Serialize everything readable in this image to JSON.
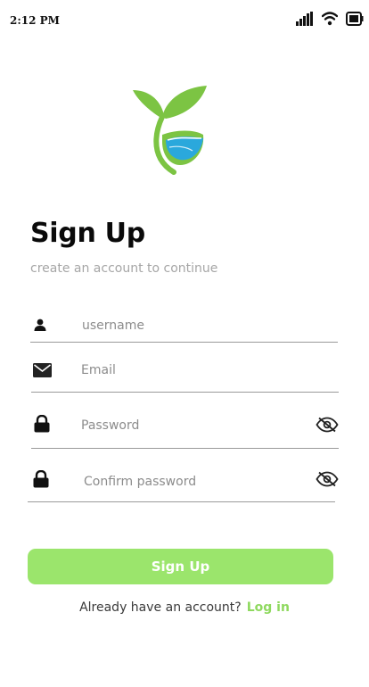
{
  "status_bar": {
    "time": "2:12 PM"
  },
  "header": {
    "title": "Sign Up",
    "subtitle": "create an account to continue"
  },
  "form": {
    "username": {
      "placeholder": "username",
      "value": ""
    },
    "email": {
      "placeholder": "Email",
      "value": ""
    },
    "password": {
      "placeholder": "Password",
      "value": ""
    },
    "confirm_password": {
      "placeholder": "Confirm password",
      "value": ""
    },
    "submit_label": "Sign Up"
  },
  "footer": {
    "prompt": "Already have an account?",
    "login_label": "Log in"
  },
  "colors": {
    "accent": "#9be56c",
    "link": "#8fd95f",
    "logo_leaf": "#7cc443",
    "logo_water": "#2aa8dc"
  }
}
